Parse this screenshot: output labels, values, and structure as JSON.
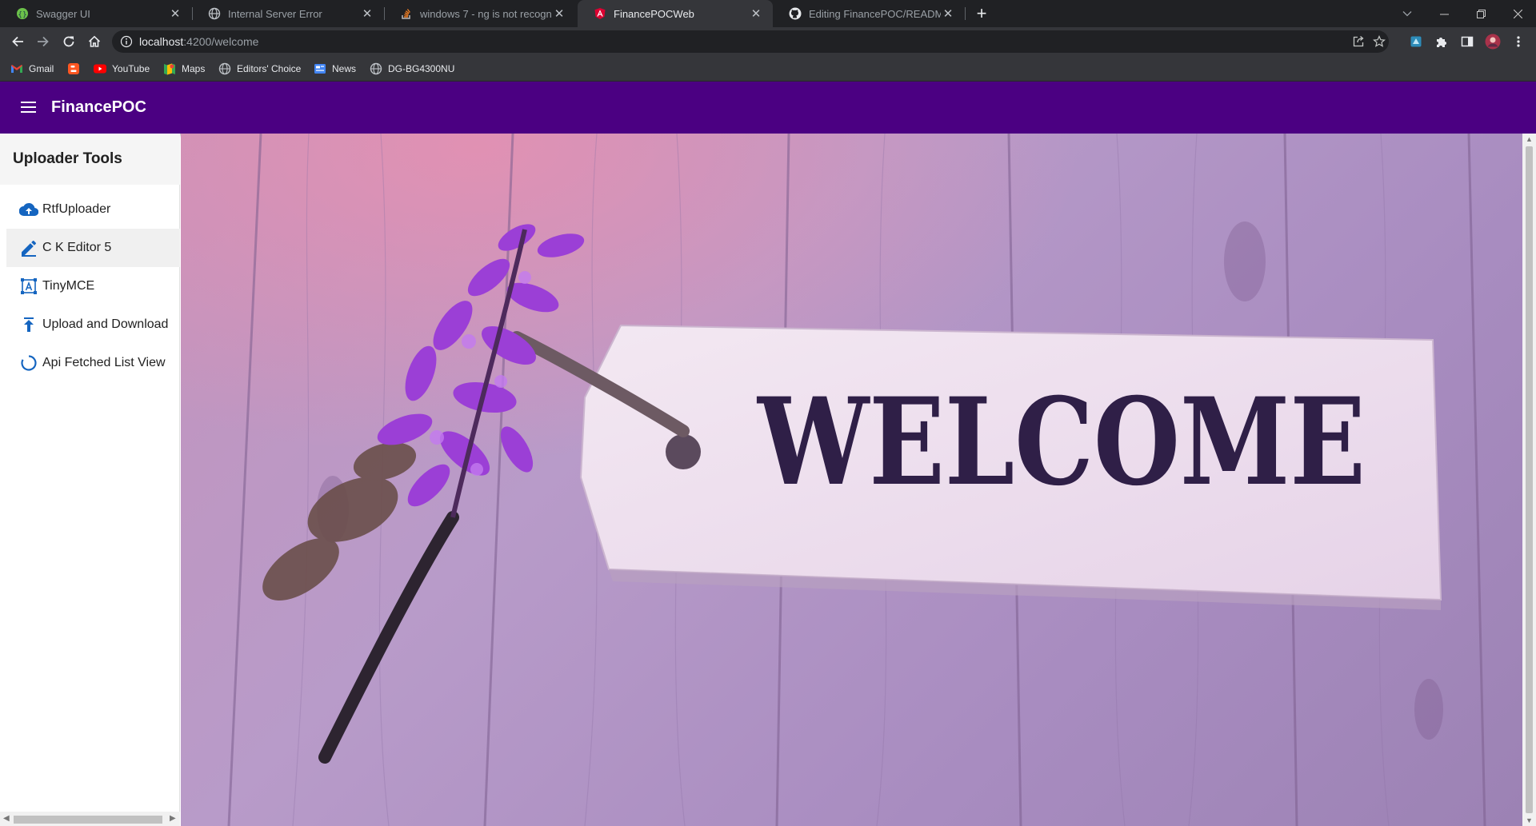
{
  "browser": {
    "tabs": [
      {
        "title": "Swagger UI",
        "icon": "swagger-icon",
        "active": false
      },
      {
        "title": "Internal Server Error",
        "icon": "globe-icon",
        "active": false
      },
      {
        "title": "windows 7 - ng is not recognized",
        "icon": "stackoverflow-icon",
        "active": false
      },
      {
        "title": "FinancePOCWeb",
        "icon": "angular-icon",
        "active": true
      },
      {
        "title": "Editing FinancePOC/README.md",
        "icon": "github-icon",
        "active": false
      }
    ],
    "new_tab_label": "+",
    "url_host": "localhost",
    "url_path": ":4200/welcome",
    "bookmarks": [
      {
        "label": "Gmail",
        "icon": "gmail-icon"
      },
      {
        "label": "",
        "icon": "blogger-icon"
      },
      {
        "label": "YouTube",
        "icon": "youtube-icon"
      },
      {
        "label": "Maps",
        "icon": "maps-icon"
      },
      {
        "label": "Editors' Choice",
        "icon": "globe-icon"
      },
      {
        "label": "News",
        "icon": "news-icon"
      },
      {
        "label": "DG-BG4300NU",
        "icon": "globe-icon"
      }
    ]
  },
  "app": {
    "title": "FinancePOC",
    "brand_color": "#4b0082"
  },
  "sidebar": {
    "heading": "Uploader Tools",
    "items": [
      {
        "label": "RtfUploader",
        "icon": "cloud-upload-icon",
        "active": false
      },
      {
        "label": "C K Editor 5",
        "icon": "edit-pencil-icon",
        "active": true
      },
      {
        "label": "TinyMCE",
        "icon": "text-box-icon",
        "active": false
      },
      {
        "label": "Upload and Download",
        "icon": "upload-arrow-icon",
        "active": false
      },
      {
        "label": "Api Fetched List View",
        "icon": "loading-circle-icon",
        "active": false
      }
    ]
  },
  "main": {
    "welcome_text": "WELCOME"
  }
}
